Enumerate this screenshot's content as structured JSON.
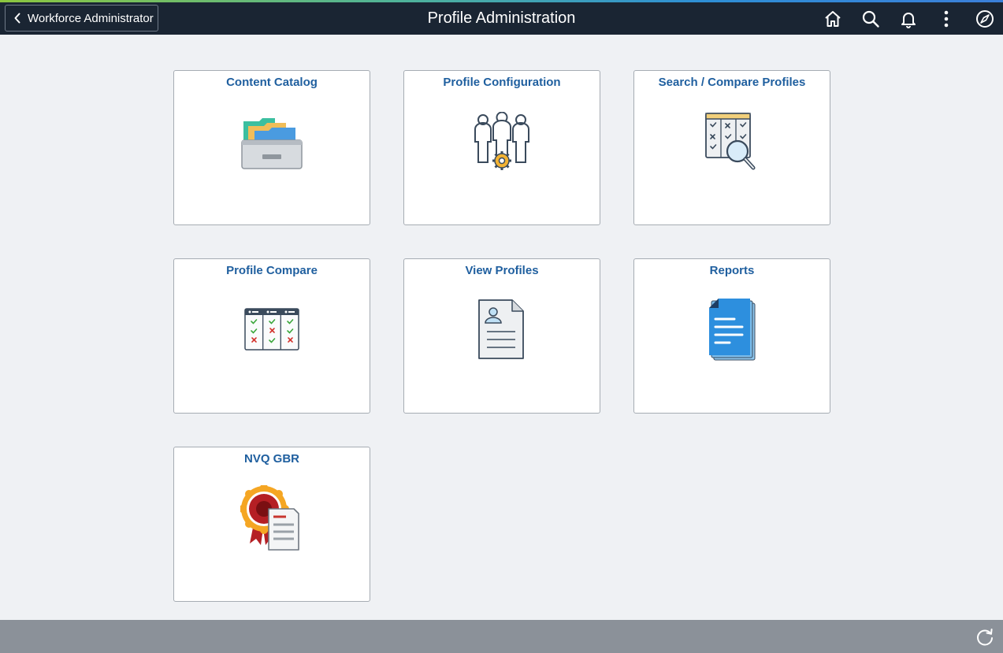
{
  "header": {
    "back_label": "Workforce Administrator",
    "title": "Profile Administration",
    "icons": [
      "home-icon",
      "search-icon",
      "bell-icon",
      "more-icon",
      "compass-icon"
    ]
  },
  "tiles": [
    {
      "title": "Content Catalog",
      "icon": "folder-drawer-icon"
    },
    {
      "title": "Profile Configuration",
      "icon": "people-gear-icon"
    },
    {
      "title": "Search / Compare Profiles",
      "icon": "checklist-magnifier-icon"
    },
    {
      "title": "Profile Compare",
      "icon": "compare-grid-icon"
    },
    {
      "title": "View Profiles",
      "icon": "profile-document-icon"
    },
    {
      "title": "Reports",
      "icon": "report-pages-icon"
    },
    {
      "title": "NVQ GBR",
      "icon": "certificate-award-icon"
    }
  ],
  "footer": {
    "icon": "refresh-icon"
  },
  "colors": {
    "header_bg": "#1a2533",
    "page_bg": "#eff1f4",
    "tile_title": "#1f5f9f",
    "footer_bg": "#8b9199"
  }
}
